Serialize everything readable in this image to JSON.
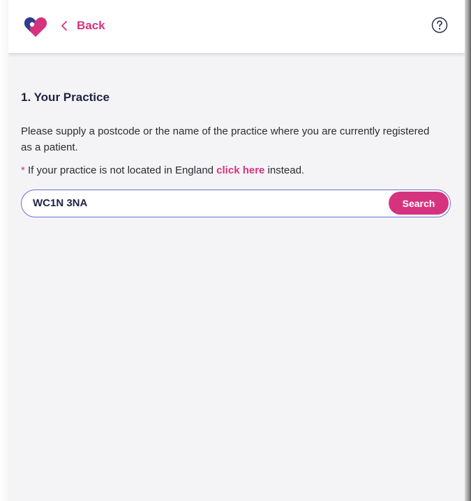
{
  "header": {
    "back_label": "Back"
  },
  "section": {
    "title": "1. Your Practice",
    "description": "Please supply a postcode or the name of the practice where you are currently registered as a patient.",
    "note_asterisk": "*",
    "note_prefix": " If your practice is not located in England ",
    "note_link": "click here",
    "note_suffix": " instead."
  },
  "search": {
    "value": "WC1N 3NA",
    "button_label": "Search"
  },
  "colors": {
    "accent": "#d6337f",
    "heading": "#1f2340",
    "input_border": "#6a6fd3",
    "logo_blue": "#2d3e8f"
  }
}
